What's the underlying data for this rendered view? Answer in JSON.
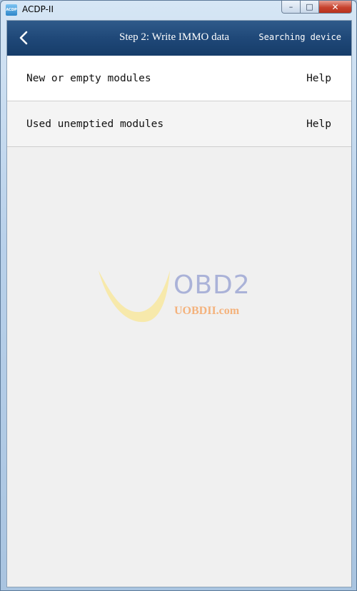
{
  "window": {
    "title": "ACDP-II",
    "icon_text": "ACDP",
    "controls": {
      "minimize": "–",
      "maximize": "□",
      "close": "✕"
    }
  },
  "header": {
    "back_icon": "chevron-left-icon",
    "title": "Step 2: Write IMMO data",
    "status": "Searching device"
  },
  "options": [
    {
      "label": "New or empty modules",
      "help": "Help"
    },
    {
      "label": "Used unemptied modules",
      "help": "Help"
    }
  ],
  "watermark": {
    "brand": "OBD2",
    "url": "UOBDII.com"
  },
  "colors": {
    "header": "#1f4878",
    "content_bg": "#f0f0f0",
    "row_bg": "#ffffff",
    "watermark_brand": "#aab2d8",
    "watermark_url": "#f4b27c"
  }
}
